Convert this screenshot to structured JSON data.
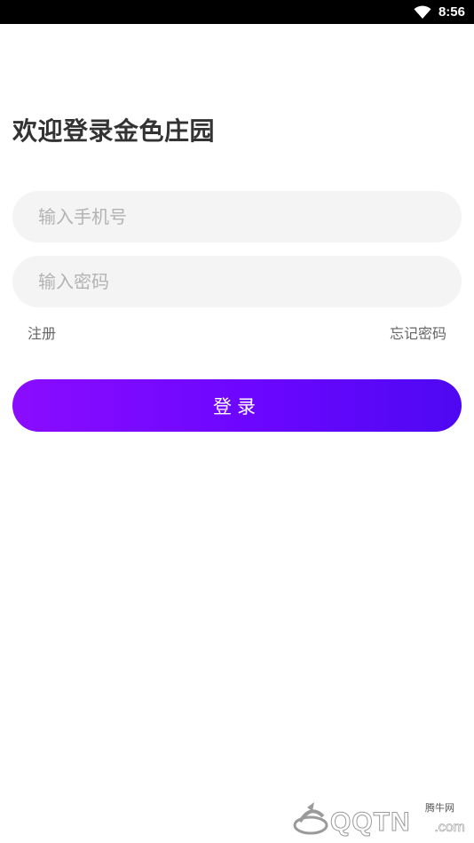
{
  "status_bar": {
    "time": "8:56",
    "wifi_icon": "wifi-icon"
  },
  "login": {
    "title": "欢迎登录金色庄园",
    "phone_placeholder": "输入手机号",
    "password_placeholder": "输入密码",
    "register_label": "注册",
    "forgot_label": "忘记密码",
    "login_label": "登录",
    "button_gradient": [
      "#8a0cff",
      "#4e08f2"
    ]
  },
  "watermark": {
    "brand": "QQTN",
    "suffix": ".com",
    "cn_text": "腾牛网"
  }
}
